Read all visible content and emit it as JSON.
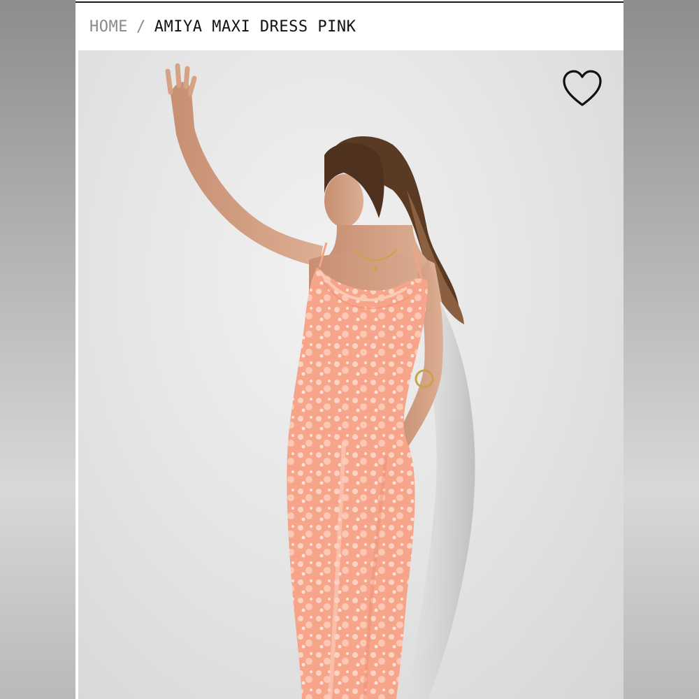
{
  "breadcrumb": {
    "home_label": "HOME",
    "separator": "/",
    "current_label": "AMIYA MAXI DRESS PINK"
  },
  "product": {
    "image_alt": "Model wearing Amiya Maxi Dress in pink",
    "wishlist_icon": "heart-outline-icon"
  },
  "colors": {
    "dress": "#f4a487",
    "accent": "#111111"
  }
}
